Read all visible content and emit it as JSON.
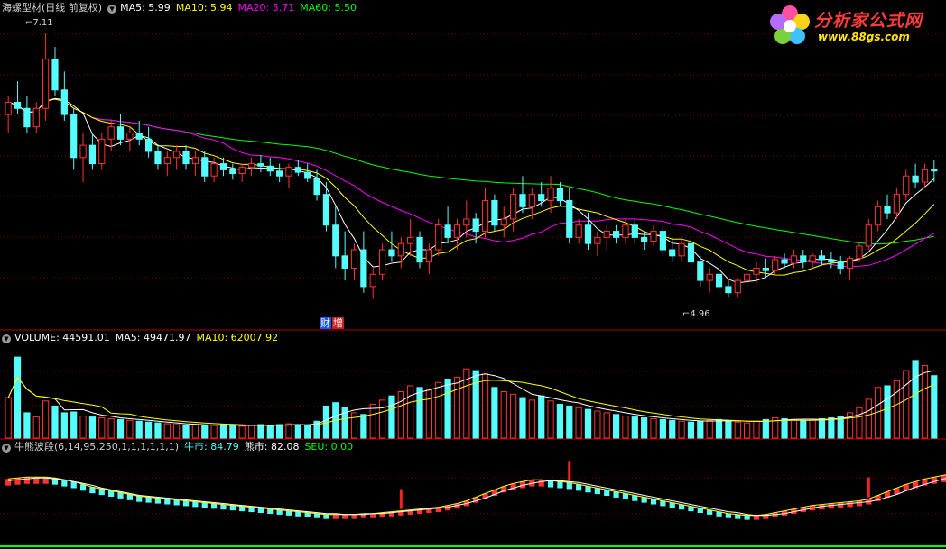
{
  "price_panel": {
    "stock_name": "海螺型材",
    "period": "(日线 前复权)",
    "ma5": "MA5: 5.99",
    "ma10": "MA10: 5.94",
    "ma20": "MA20: 5.71",
    "ma60": "MA60: 5.50",
    "high_label": "7.11",
    "low_label": "4.96",
    "badge_cai": "财",
    "badge_zeng": "增"
  },
  "volume_panel": {
    "volume": "VOLUME: 44591.01",
    "ma5": "MA5: 49471.97",
    "ma10": "MA10: 62007.92"
  },
  "indicator_panel": {
    "name": "牛熊波段(6,14,95,250,1,1,1,1,1,1)",
    "bull": "牛市: 84.79",
    "bear": "熊市: 82.08",
    "seu": "SEU: 0.00"
  },
  "logo": {
    "title": "分析家公式网",
    "url": "www.88gs.com"
  },
  "colors": {
    "up": "#ff3232",
    "down": "#54fcfc",
    "ma5": "#ffffff",
    "ma10": "#ffff00",
    "ma20": "#ff00ff",
    "ma60": "#00ff00",
    "grid": "#7a0000",
    "bull": "#ffff00",
    "bear": "#ffffff",
    "seu": "#00ff00"
  },
  "chart_data": {
    "type": "candlestick",
    "ylim": [
      4.8,
      7.25
    ],
    "candles": [
      [
        6.45,
        6.6,
        6.3,
        6.55
      ],
      [
        6.55,
        6.72,
        6.45,
        6.5
      ],
      [
        6.5,
        6.6,
        6.3,
        6.35
      ],
      [
        6.35,
        6.55,
        6.3,
        6.5
      ],
      [
        6.5,
        7.11,
        6.4,
        6.9
      ],
      [
        6.9,
        7.0,
        6.6,
        6.65
      ],
      [
        6.65,
        6.8,
        6.4,
        6.45
      ],
      [
        6.45,
        6.5,
        6.0,
        6.1
      ],
      [
        6.1,
        6.3,
        5.9,
        6.2
      ],
      [
        6.2,
        6.3,
        6.0,
        6.05
      ],
      [
        6.05,
        6.3,
        6.0,
        6.25
      ],
      [
        6.25,
        6.4,
        6.15,
        6.35
      ],
      [
        6.35,
        6.45,
        6.2,
        6.25
      ],
      [
        6.25,
        6.35,
        6.15,
        6.3
      ],
      [
        6.3,
        6.4,
        6.2,
        6.25
      ],
      [
        6.25,
        6.35,
        6.1,
        6.15
      ],
      [
        6.15,
        6.2,
        6.0,
        6.05
      ],
      [
        6.05,
        6.15,
        5.95,
        6.1
      ],
      [
        6.1,
        6.2,
        6.0,
        6.15
      ],
      [
        6.15,
        6.2,
        6.0,
        6.05
      ],
      [
        6.05,
        6.15,
        5.95,
        6.1
      ],
      [
        6.1,
        6.15,
        5.9,
        5.95
      ],
      [
        5.95,
        6.1,
        5.9,
        6.05
      ],
      [
        6.05,
        6.1,
        5.95,
        6.0
      ],
      [
        6.0,
        6.05,
        5.92,
        5.97
      ],
      [
        5.97,
        6.05,
        5.9,
        6.02
      ],
      [
        6.02,
        6.1,
        5.95,
        6.05
      ],
      [
        6.05,
        6.12,
        5.98,
        6.03
      ],
      [
        6.03,
        6.1,
        5.95,
        5.99
      ],
      [
        5.99,
        6.05,
        5.9,
        5.95
      ],
      [
        5.95,
        6.05,
        5.85,
        6.02
      ],
      [
        6.02,
        6.08,
        5.95,
        5.98
      ],
      [
        5.98,
        6.05,
        5.9,
        5.93
      ],
      [
        5.93,
        6.0,
        5.75,
        5.8
      ],
      [
        5.8,
        5.9,
        5.5,
        5.55
      ],
      [
        5.55,
        5.7,
        5.2,
        5.3
      ],
      [
        5.3,
        5.5,
        5.1,
        5.2
      ],
      [
        5.2,
        5.4,
        5.1,
        5.35
      ],
      [
        5.35,
        5.5,
        5.0,
        5.05
      ],
      [
        5.05,
        5.2,
        4.95,
        5.15
      ],
      [
        5.15,
        5.4,
        5.1,
        5.35
      ],
      [
        5.35,
        5.5,
        5.25,
        5.3
      ],
      [
        5.3,
        5.45,
        5.2,
        5.4
      ],
      [
        5.4,
        5.6,
        5.3,
        5.45
      ],
      [
        5.45,
        5.5,
        5.2,
        5.25
      ],
      [
        5.25,
        5.4,
        5.15,
        5.35
      ],
      [
        5.35,
        5.6,
        5.3,
        5.55
      ],
      [
        5.55,
        5.7,
        5.4,
        5.45
      ],
      [
        5.45,
        5.6,
        5.35,
        5.55
      ],
      [
        5.55,
        5.75,
        5.45,
        5.6
      ],
      [
        5.6,
        5.65,
        5.4,
        5.5
      ],
      [
        5.5,
        5.85,
        5.45,
        5.75
      ],
      [
        5.75,
        5.8,
        5.5,
        5.55
      ],
      [
        5.55,
        5.7,
        5.45,
        5.6
      ],
      [
        5.6,
        5.85,
        5.5,
        5.8
      ],
      [
        5.8,
        5.95,
        5.65,
        5.7
      ],
      [
        5.7,
        5.85,
        5.6,
        5.8
      ],
      [
        5.8,
        5.9,
        5.7,
        5.75
      ],
      [
        5.75,
        5.95,
        5.65,
        5.85
      ],
      [
        5.85,
        5.9,
        5.7,
        5.75
      ],
      [
        5.75,
        5.85,
        5.4,
        5.45
      ],
      [
        5.45,
        5.6,
        5.4,
        5.55
      ],
      [
        5.55,
        5.65,
        5.35,
        5.4
      ],
      [
        5.4,
        5.5,
        5.3,
        5.45
      ],
      [
        5.45,
        5.55,
        5.35,
        5.5
      ],
      [
        5.5,
        5.55,
        5.4,
        5.45
      ],
      [
        5.45,
        5.6,
        5.4,
        5.55
      ],
      [
        5.55,
        5.6,
        5.4,
        5.45
      ],
      [
        5.45,
        5.5,
        5.35,
        5.42
      ],
      [
        5.42,
        5.55,
        5.38,
        5.5
      ],
      [
        5.5,
        5.55,
        5.3,
        5.35
      ],
      [
        5.35,
        5.45,
        5.25,
        5.3
      ],
      [
        5.3,
        5.45,
        5.25,
        5.4
      ],
      [
        5.4,
        5.45,
        5.2,
        5.25
      ],
      [
        5.25,
        5.3,
        5.05,
        5.1
      ],
      [
        5.1,
        5.2,
        5.0,
        5.15
      ],
      [
        5.15,
        5.2,
        5.0,
        5.05
      ],
      [
        5.05,
        5.1,
        4.96,
        5.0
      ],
      [
        5.0,
        5.12,
        4.96,
        5.1
      ],
      [
        5.1,
        5.2,
        5.05,
        5.15
      ],
      [
        5.15,
        5.25,
        5.08,
        5.2
      ],
      [
        5.2,
        5.28,
        5.12,
        5.18
      ],
      [
        5.18,
        5.3,
        5.15,
        5.27
      ],
      [
        5.27,
        5.32,
        5.2,
        5.24
      ],
      [
        5.24,
        5.35,
        5.2,
        5.3
      ],
      [
        5.3,
        5.35,
        5.2,
        5.25
      ],
      [
        5.25,
        5.32,
        5.2,
        5.3
      ],
      [
        5.3,
        5.35,
        5.22,
        5.27
      ],
      [
        5.27,
        5.33,
        5.2,
        5.25
      ],
      [
        5.25,
        5.3,
        5.15,
        5.2
      ],
      [
        5.2,
        5.3,
        5.1,
        5.28
      ],
      [
        5.28,
        5.4,
        5.25,
        5.38
      ],
      [
        5.38,
        5.6,
        5.35,
        5.55
      ],
      [
        5.55,
        5.75,
        5.5,
        5.7
      ],
      [
        5.7,
        5.8,
        5.6,
        5.65
      ],
      [
        5.65,
        5.85,
        5.6,
        5.8
      ],
      [
        5.8,
        6.0,
        5.75,
        5.95
      ],
      [
        5.95,
        6.05,
        5.85,
        5.9
      ],
      [
        5.9,
        6.05,
        5.85,
        6.0
      ],
      [
        6.0,
        6.08,
        5.9,
        5.99
      ]
    ],
    "volume_ylim": [
      0,
      110000
    ],
    "volume": [
      48000,
      96000,
      30000,
      25000,
      44000,
      38000,
      30000,
      31000,
      26000,
      25000,
      24000,
      23000,
      22000,
      21000,
      20000,
      19000,
      18000,
      17000,
      16000,
      15000,
      16000,
      15000,
      15000,
      16000,
      15000,
      14000,
      15000,
      16000,
      15000,
      16000,
      17000,
      16000,
      15000,
      20000,
      38000,
      42000,
      36000,
      30000,
      28000,
      40000,
      45000,
      50000,
      55000,
      62000,
      60000,
      58000,
      66000,
      70000,
      72000,
      82000,
      80000,
      76000,
      60000,
      55000,
      52000,
      48000,
      45000,
      50000,
      44000,
      40000,
      38000,
      36000,
      34000,
      32000,
      30000,
      28000,
      26000,
      25000,
      24000,
      23000,
      22000,
      21000,
      20000,
      19000,
      20000,
      21000,
      22000,
      20000,
      19000,
      18000,
      20000,
      22000,
      24000,
      23000,
      22000,
      21000,
      22000,
      23000,
      24000,
      26000,
      30000,
      36000,
      46000,
      60000,
      62000,
      68000,
      80000,
      92000,
      86000,
      74000
    ],
    "indicator_ylim": [
      0,
      100
    ],
    "bull_line": [
      72,
      73,
      74,
      74,
      74,
      73,
      71,
      69,
      66,
      63,
      61,
      59,
      57,
      55,
      53,
      52,
      51,
      50,
      49,
      48,
      47,
      46,
      45,
      44,
      43,
      42,
      41,
      40,
      39,
      38,
      37,
      36,
      35,
      34,
      33,
      33,
      33,
      33,
      34,
      34,
      35,
      36,
      37,
      38,
      39,
      40,
      41,
      43,
      45,
      48,
      52,
      56,
      60,
      64,
      67,
      69,
      71,
      71,
      70,
      69,
      68,
      66,
      64,
      62,
      60,
      58,
      56,
      54,
      52,
      50,
      48,
      46,
      44,
      42,
      40,
      38,
      36,
      34,
      33,
      32,
      32,
      33,
      35,
      37,
      39,
      41,
      43,
      44,
      45,
      46,
      47,
      48,
      50,
      54,
      58,
      62,
      66,
      69,
      72,
      74,
      76,
      78,
      80,
      82,
      84,
      84.79
    ],
    "bear_line": [
      70,
      71,
      72,
      73,
      73,
      72,
      71,
      69,
      67,
      65,
      62,
      60,
      58,
      56,
      54,
      53,
      52,
      51,
      50,
      49,
      48,
      47,
      46,
      45,
      44,
      43,
      42,
      41,
      40,
      39,
      38,
      37,
      36,
      35,
      34,
      34,
      33,
      33,
      33,
      34,
      34,
      35,
      36,
      37,
      38,
      39,
      40,
      41,
      43,
      45,
      48,
      51,
      55,
      59,
      62,
      65,
      67,
      69,
      70,
      70,
      69,
      68,
      66,
      64,
      62,
      60,
      58,
      56,
      54,
      52,
      50,
      48,
      46,
      44,
      42,
      40,
      38,
      36,
      35,
      33,
      32,
      32,
      33,
      34,
      36,
      38,
      40,
      42,
      43,
      44,
      45,
      46,
      47,
      49,
      52,
      55,
      59,
      63,
      66,
      69,
      72,
      74,
      76,
      78,
      80,
      81,
      82.08
    ],
    "signals": [
      42,
      60,
      92
    ]
  }
}
